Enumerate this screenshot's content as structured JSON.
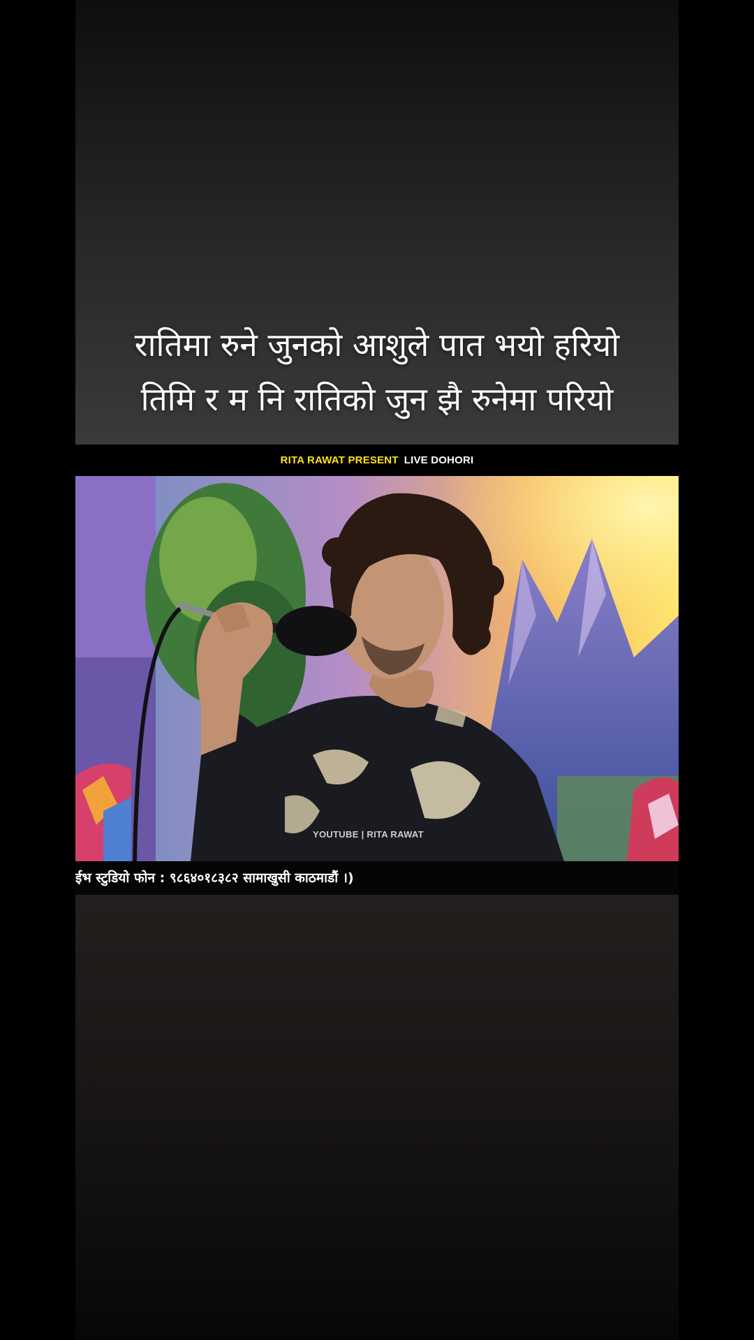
{
  "lyrics": {
    "line1": "रातिमा रुने जुनको आशुले पात भयो हरियो",
    "line2": "तिमि र म नि रातिको जुन झै रुनेमा परियो"
  },
  "video": {
    "header_presenter": "RITA RAWAT PRESENT",
    "header_show": "LIVE DOHORI",
    "watermark": "YOUTUBE | RITA RAWAT",
    "ticker": "ईभ स्टुडियो फोन : ९८६४०१८३८२ सामाखुसी काठमाडौं ।)"
  },
  "colors": {
    "background": "#000000",
    "header_accent": "#ffe21a",
    "lyric_text": "#ffffff"
  }
}
